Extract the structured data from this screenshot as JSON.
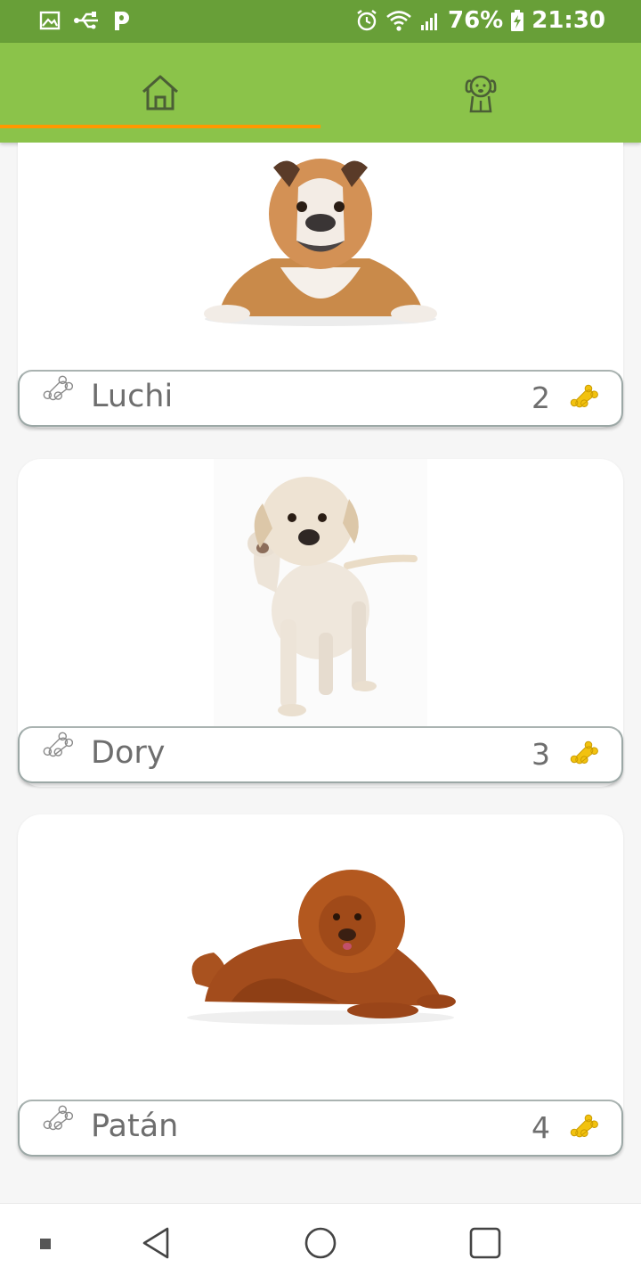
{
  "status_bar": {
    "battery": "76%",
    "time": "21:30",
    "left_icons": [
      "image-icon",
      "usb-icon",
      "parking-icon"
    ],
    "right_icons": [
      "alarm-icon",
      "wifi-icon",
      "signal-icon",
      "battery-charging-icon"
    ]
  },
  "tabs": [
    {
      "name": "home",
      "icon": "home-icon",
      "selected": true
    },
    {
      "name": "pets",
      "icon": "dog-icon",
      "selected": false
    }
  ],
  "colors": {
    "status_bar": "#689f38",
    "tab_bar": "#8bc34a",
    "tab_indicator": "#ff9800",
    "bone_filled": "#f2c20f",
    "text": "#6e6e6e"
  },
  "dogs": [
    {
      "name": "Luchi",
      "likes": "2",
      "breed_image": "bulldog-photo"
    },
    {
      "name": "Dory",
      "likes": "3",
      "breed_image": "labrador-puppy-photo"
    },
    {
      "name": "Patán",
      "likes": "4",
      "breed_image": "tibetan-mastiff-photo"
    }
  ],
  "nav_bar": [
    "square-dot-icon",
    "back-icon",
    "home-circle-icon",
    "recents-icon"
  ]
}
